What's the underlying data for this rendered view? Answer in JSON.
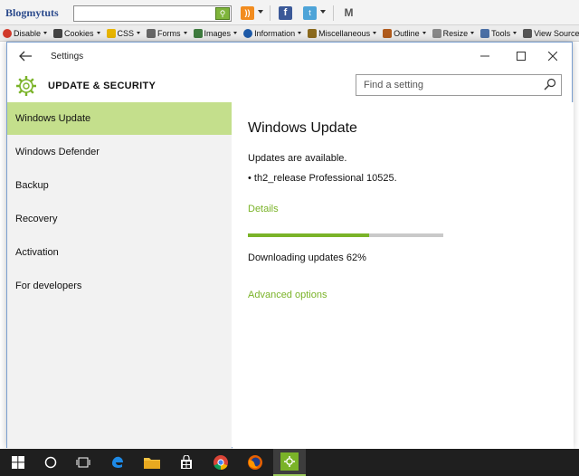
{
  "browser": {
    "brand": "Blogmytuts",
    "devbar": [
      {
        "label": "Disable",
        "icon": "disable-icon",
        "color": "#d23a2b"
      },
      {
        "label": "Cookies",
        "icon": "cookies-icon",
        "color": "#444444"
      },
      {
        "label": "CSS",
        "icon": "css-icon",
        "color": "#e7b400"
      },
      {
        "label": "Forms",
        "icon": "forms-icon",
        "color": "#666666"
      },
      {
        "label": "Images",
        "icon": "images-icon",
        "color": "#3e7b3e"
      },
      {
        "label": "Information",
        "icon": "information-icon",
        "color": "#1d5aa8"
      },
      {
        "label": "Miscellaneous",
        "icon": "miscellaneous-icon",
        "color": "#8b6a1e"
      },
      {
        "label": "Outline",
        "icon": "outline-icon",
        "color": "#b05b1c"
      },
      {
        "label": "Resize",
        "icon": "resize-icon",
        "color": "#888888"
      },
      {
        "label": "Tools",
        "icon": "tools-icon",
        "color": "#4a6fa5"
      },
      {
        "label": "View Source",
        "icon": "view-source-icon",
        "color": "#555555"
      }
    ]
  },
  "window": {
    "title": "Settings",
    "section_title": "UPDATE & SECURITY",
    "search_placeholder": "Find a setting"
  },
  "sidebar": {
    "items": [
      {
        "label": "Windows Update",
        "active": true
      },
      {
        "label": "Windows Defender",
        "active": false
      },
      {
        "label": "Backup",
        "active": false
      },
      {
        "label": "Recovery",
        "active": false
      },
      {
        "label": "Activation",
        "active": false
      },
      {
        "label": "For developers",
        "active": false
      }
    ]
  },
  "main": {
    "heading": "Windows Update",
    "available_text": "Updates are available.",
    "update_item": "• th2_release Professional 10525.",
    "details_link": "Details",
    "progress_fraction": 0.62,
    "status_text": "Downloading updates 62%",
    "advanced_link": "Advanced options"
  },
  "colors": {
    "accent": "#7ab328",
    "active_nav": "#c4df8c",
    "taskbar": "#1f1f1f"
  },
  "taskbar": {
    "items": [
      "windows-start-icon",
      "cortana-icon",
      "task-view-icon",
      "edge-icon",
      "file-explorer-icon",
      "store-icon",
      "chrome-icon",
      "firefox-icon",
      "settings-icon"
    ]
  }
}
